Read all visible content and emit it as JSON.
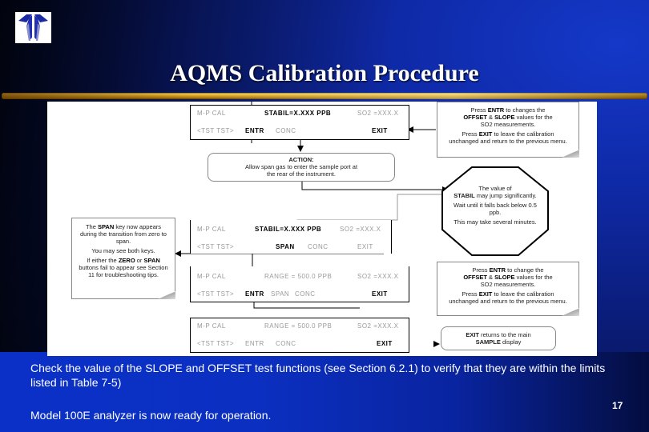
{
  "slide": {
    "title": "AQMS Calibration Procedure",
    "page_number": "17",
    "logo": "teledyne-logo",
    "colors": {
      "background": "#0f2aa8",
      "accent_bar": "#d9a520",
      "title_text": "#ffffff"
    }
  },
  "diagram": {
    "screens": [
      {
        "id": "screen-1",
        "top_left": "M-P CAL",
        "top_mid": "STABIL=X.XXX PPB",
        "top_right": "SO2 =XXX.X",
        "bottom_left": "<TST TST>",
        "bottom_key1": "ENTR",
        "bottom_key2": "CONC",
        "bottom_right": "EXIT"
      },
      {
        "id": "screen-2",
        "top_left": "M-P CAL",
        "top_mid": "STABIL=X.XXX PPB",
        "top_right": "SO2 =XXX.X",
        "bottom_left": "<TST TST>",
        "bottom_key1": "SPAN",
        "bottom_key2": "CONC",
        "bottom_right": "EXIT"
      },
      {
        "id": "screen-3",
        "top_left": "M-P CAL",
        "top_mid": "RANGE = 500.0 PPB",
        "top_right": "SO2 =XXX.X",
        "bottom_left": "<TST TST>",
        "bottom_key1": "ENTR",
        "bottom_key2": "SPAN",
        "bottom_key3": "CONC",
        "bottom_right": "EXIT"
      },
      {
        "id": "screen-4",
        "top_left": "M-P CAL",
        "top_mid": "RANGE = 500.0 PPB",
        "top_right": "SO2 =XXX.X",
        "bottom_left": "<TST TST>",
        "bottom_key1": "ENTR",
        "bottom_key2": "CONC",
        "bottom_right": "EXIT"
      }
    ],
    "action_box": {
      "heading": "ACTION:",
      "text": "Allow span gas to enter the sample port at the rear of the instrument."
    },
    "note_top_right": {
      "line1_pre": "Press ",
      "line1_key": "ENTR",
      "line1_post": " to changes the",
      "line2_key1": "OFFSET",
      "line2_mid": " & ",
      "line2_key2": "SLOPE",
      "line2_post": " values for the",
      "line3": "SO2 measurements.",
      "line4_pre": "Press ",
      "line4_key": "EXIT",
      "line4_post": " to leave the calibration unchanged and return to the previous menu."
    },
    "octagon": {
      "line1_pre": "The value of",
      "line1_key": "STABIL",
      "line1_post": " may jump significantly.",
      "line2": "Wait until it falls back below 0.5 ppb.",
      "line3": "This may take several minutes."
    },
    "note_left": {
      "line1_pre": "The ",
      "line1_key": "SPAN",
      "line1_post": " key now appears during the transition from zero to span.",
      "line2": "You may see both keys.",
      "line3_pre": "If either the ",
      "line3_key1": "ZERO",
      "line3_mid": " or ",
      "line3_key2": "SPAN",
      "line3_post": " buttons fail to appear see Section 11 for troubleshooting tips."
    },
    "note_mid_right": {
      "line1_pre": "Press ",
      "line1_key": "ENTR",
      "line1_post": " to change the",
      "line2_key1": "OFFSET",
      "line2_mid": " & ",
      "line2_key2": "SLOPE",
      "line2_post": " values for the",
      "line3": "SO2 measurements.",
      "line4_pre": "Press ",
      "line4_key": "EXIT",
      "line4_post": " to leave the calibration unchanged and return to the previous menu."
    },
    "exit_box": {
      "key1": "EXIT",
      "text1": " returns to the main",
      "key2": "SAMPLE",
      "text2": " display"
    }
  },
  "body": {
    "paragraph1": "Check the value of the SLOPE and OFFSET test functions (see Section 6.2.1) to verify that they are within the limits listed in Table 7-5)",
    "paragraph2": "Model 100E analyzer is now ready for operation."
  }
}
